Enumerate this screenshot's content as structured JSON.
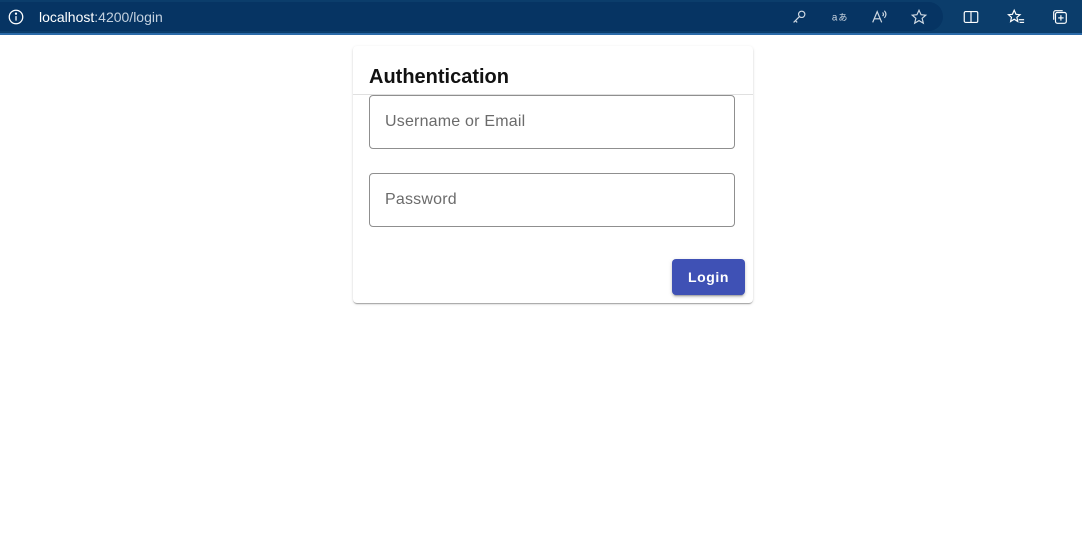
{
  "browser": {
    "url_host": "localhost",
    "url_path": ":4200/login",
    "icons": [
      "info-icon",
      "key-icon",
      "translate-icon",
      "read-aloud-icon",
      "favorite-star-icon",
      "split-screen-icon",
      "favorites-list-icon",
      "collections-icon"
    ]
  },
  "login_card": {
    "title": "Authentication",
    "username_placeholder": "Username or Email",
    "password_placeholder": "Password",
    "login_label": "Login"
  },
  "colors": {
    "browser_bar": "#0b3d6b",
    "primary_button": "#3f51b5"
  }
}
